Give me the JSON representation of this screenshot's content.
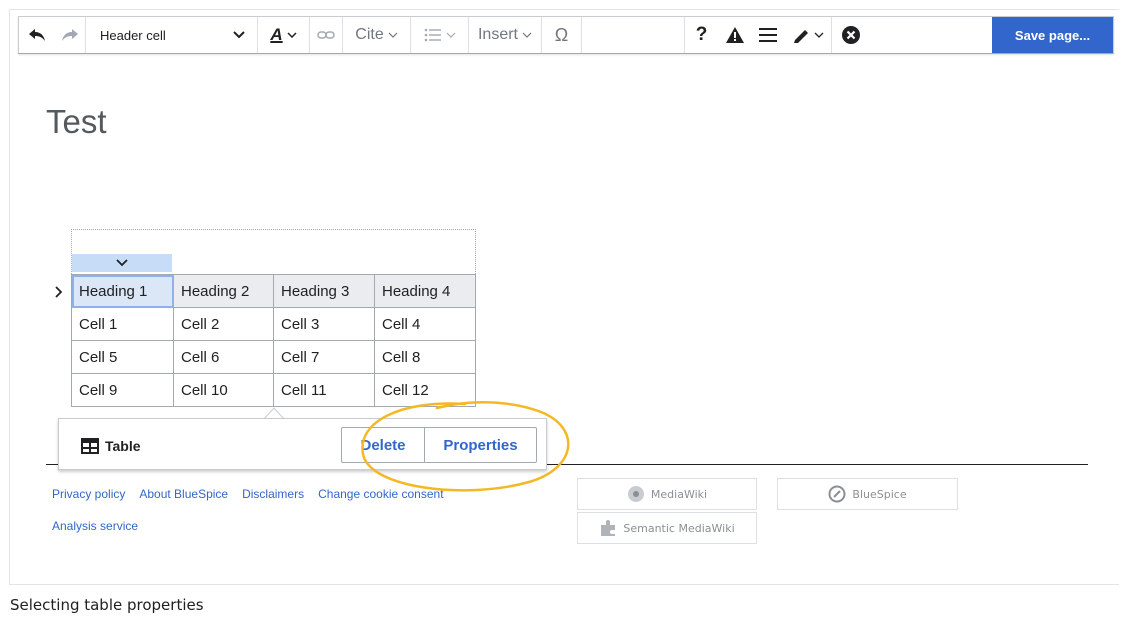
{
  "toolbar": {
    "undo_icon": "undo-icon",
    "redo_icon": "redo-icon",
    "format_select": "Header cell",
    "text_style_icon": "text-style-icon",
    "link_icon": "link-icon",
    "cite_label": "Cite",
    "list_icon": "list-icon",
    "insert_label": "Insert",
    "special_char": "Ω",
    "help_icon": "help-icon",
    "notices_icon": "warning-icon",
    "page_options_icon": "menu-icon",
    "edit_mode_icon": "pencil-icon",
    "cancel_icon": "close-circle-icon",
    "save_label": "Save page..."
  },
  "page": {
    "title": "Test"
  },
  "table": {
    "headers": [
      "Heading 1",
      "Heading 2",
      "Heading 3",
      "Heading 4"
    ],
    "rows": [
      [
        "Cell 1",
        "Cell 2",
        "Cell 3",
        "Cell 4"
      ],
      [
        "Cell 5",
        "Cell 6",
        "Cell 7",
        "Cell 8"
      ],
      [
        "Cell 9",
        "Cell 10",
        "Cell 11",
        "Cell 12"
      ]
    ]
  },
  "context": {
    "label": "Table",
    "delete_label": "Delete",
    "properties_label": "Properties"
  },
  "footer": {
    "links_row1": [
      "Privacy policy",
      "About BlueSpice",
      "Disclaimers",
      "Change cookie consent"
    ],
    "links_row2": [
      "Analysis service"
    ],
    "badges": {
      "mediawiki": "MediaWiki",
      "bluespice": "BlueSpice",
      "smw": "Semantic MediaWiki"
    }
  },
  "caption": "Selecting table properties",
  "colors": {
    "accent": "#3366cc",
    "highlight": "#f5b824",
    "selected_header": "#dbe6f6"
  }
}
